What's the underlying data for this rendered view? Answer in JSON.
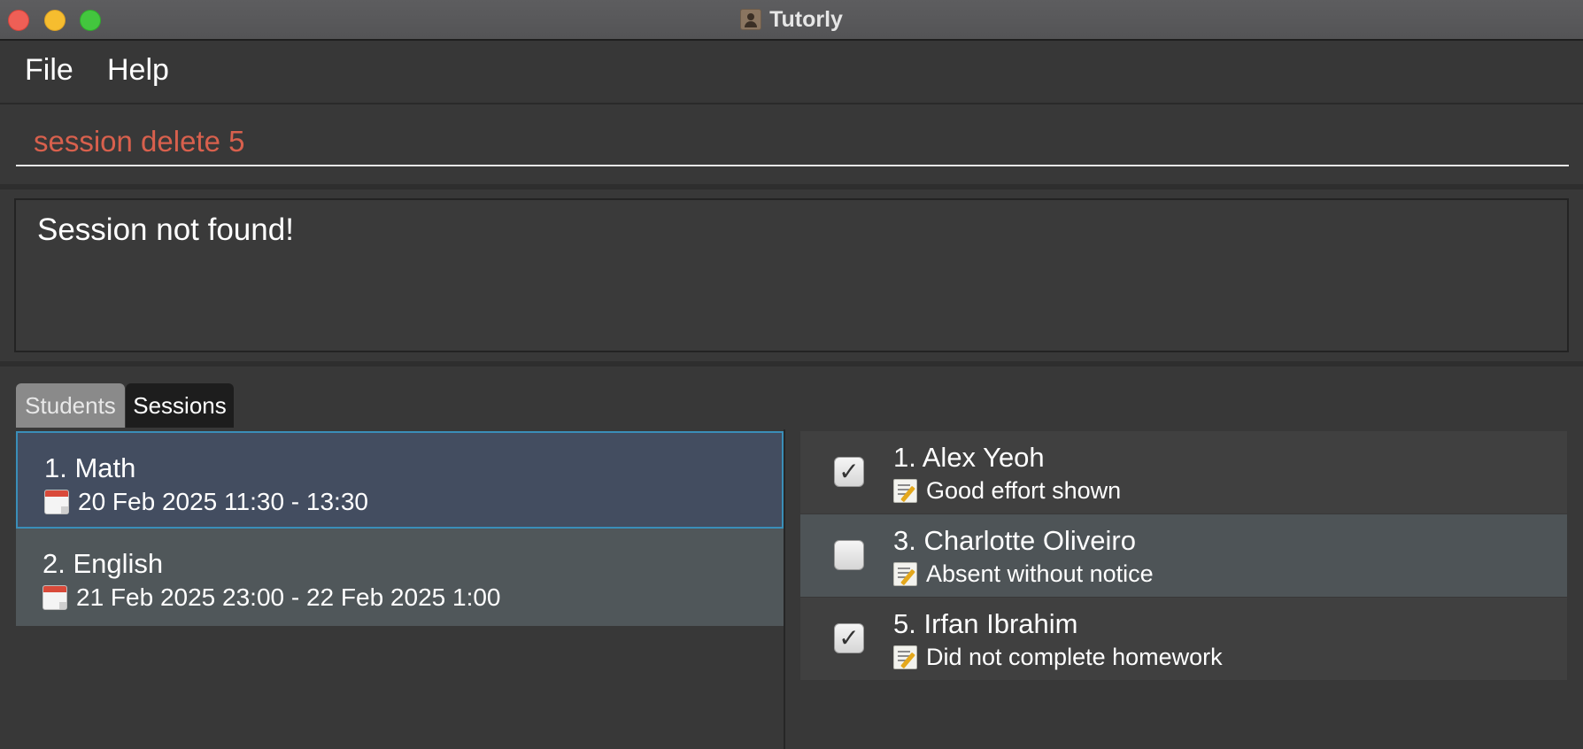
{
  "window": {
    "title": "Tutorly",
    "traffic_lights": {
      "close": "#ee5f56",
      "minimize": "#f6bd2f",
      "zoom": "#43c63e"
    }
  },
  "menu": {
    "items": [
      {
        "label": "File"
      },
      {
        "label": "Help"
      }
    ]
  },
  "command": {
    "value": "session delete 5",
    "text_color": "#d8604d"
  },
  "result": {
    "message": "Session not found!"
  },
  "tabs": [
    {
      "label": "Students",
      "selected": false
    },
    {
      "label": "Sessions",
      "selected": true
    }
  ],
  "sessions": [
    {
      "title": "1. Math",
      "time": "20 Feb 2025 11:30 - 13:30",
      "icon": "calendar-icon",
      "selected": true
    },
    {
      "title": "2. English",
      "time": "21 Feb 2025 23:00 - 22 Feb 2025 1:00",
      "icon": "calendar-icon",
      "selected": false
    }
  ],
  "attendance": [
    {
      "name": "1. Alex Yeoh",
      "note": "Good effort shown",
      "checked": true,
      "check_glyph": "✓",
      "icon": "memo-icon"
    },
    {
      "name": "3. Charlotte Oliveiro",
      "note": "Absent without notice",
      "checked": false,
      "check_glyph": "",
      "icon": "memo-icon"
    },
    {
      "name": "5. Irfan Ibrahim",
      "note": "Did not complete homework",
      "checked": true,
      "check_glyph": "✓",
      "icon": "memo-icon"
    }
  ],
  "colors": {
    "selected_card": "#434d60",
    "selected_border": "#3a8eb8",
    "alt_row": "#4e5457"
  }
}
